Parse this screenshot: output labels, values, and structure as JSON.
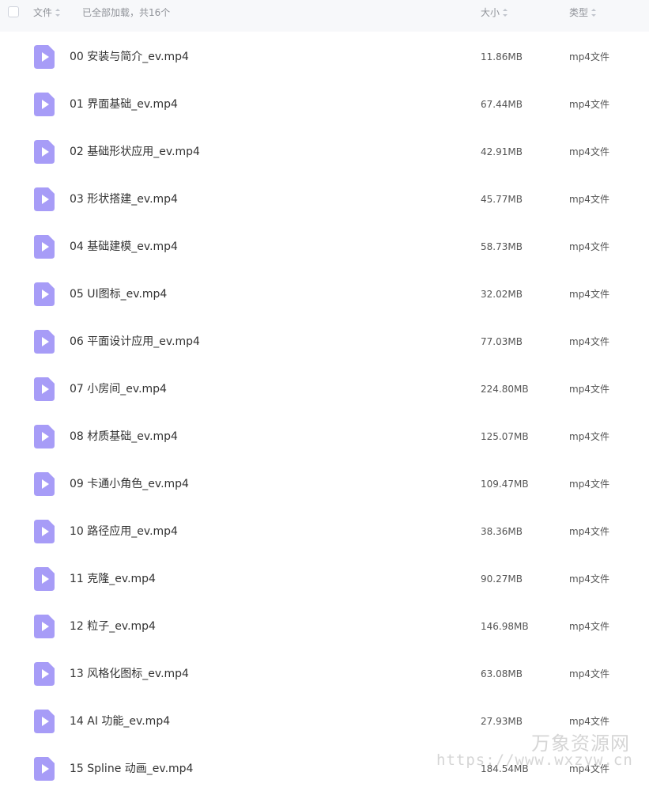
{
  "header": {
    "col_name": "文件",
    "loaded_text": "已全部加载，共16个",
    "col_size": "大小",
    "col_type": "类型"
  },
  "colors": {
    "header_bg": "#f7f8fa",
    "icon_purple": "#a79cf7",
    "text": "#333333",
    "muted": "#909399"
  },
  "icons": {
    "file": "video-file-icon",
    "sort": "sort-icon"
  },
  "files": [
    {
      "name": "00 安装与简介_ev.mp4",
      "size": "11.86MB",
      "type": "mp4文件"
    },
    {
      "name": "01 界面基础_ev.mp4",
      "size": "67.44MB",
      "type": "mp4文件"
    },
    {
      "name": "02 基础形状应用_ev.mp4",
      "size": "42.91MB",
      "type": "mp4文件"
    },
    {
      "name": "03 形状搭建_ev.mp4",
      "size": "45.77MB",
      "type": "mp4文件"
    },
    {
      "name": "04 基础建模_ev.mp4",
      "size": "58.73MB",
      "type": "mp4文件"
    },
    {
      "name": "05 UI图标_ev.mp4",
      "size": "32.02MB",
      "type": "mp4文件"
    },
    {
      "name": "06 平面设计应用_ev.mp4",
      "size": "77.03MB",
      "type": "mp4文件"
    },
    {
      "name": "07 小房间_ev.mp4",
      "size": "224.80MB",
      "type": "mp4文件"
    },
    {
      "name": "08 材质基础_ev.mp4",
      "size": "125.07MB",
      "type": "mp4文件"
    },
    {
      "name": "09 卡通小角色_ev.mp4",
      "size": "109.47MB",
      "type": "mp4文件"
    },
    {
      "name": "10 路径应用_ev.mp4",
      "size": "38.36MB",
      "type": "mp4文件"
    },
    {
      "name": "11 克隆_ev.mp4",
      "size": "90.27MB",
      "type": "mp4文件"
    },
    {
      "name": "12 粒子_ev.mp4",
      "size": "146.98MB",
      "type": "mp4文件"
    },
    {
      "name": "13 风格化图标_ev.mp4",
      "size": "63.08MB",
      "type": "mp4文件"
    },
    {
      "name": "14 AI 功能_ev.mp4",
      "size": "27.93MB",
      "type": "mp4文件"
    },
    {
      "name": "15 Spline 动画_ev.mp4",
      "size": "184.54MB",
      "type": "mp4文件"
    }
  ],
  "watermark": {
    "brand": "万象资源网",
    "url": "https://www.wxzyw.cn"
  }
}
